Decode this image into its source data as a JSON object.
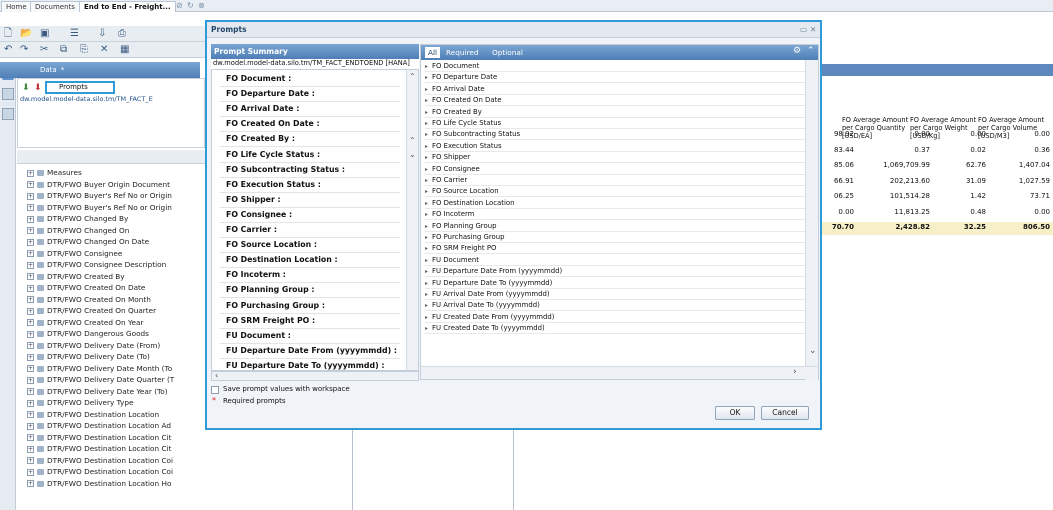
{
  "tabs": [
    {
      "label": "Home"
    },
    {
      "label": "Documents"
    },
    {
      "label": "End to End - Freight..."
    }
  ],
  "tab_icons": [
    "pin-icon",
    "refresh-icon",
    "close-icon"
  ],
  "left_panel": {
    "header": "Data",
    "prompts_label": "Prompts",
    "path": "dw.model.model-data.silo.tm/TM_FACT_E",
    "tree": [
      "Measures",
      "DTR/FWO Buyer Origin Document",
      "DTR/FWO Buyer's Ref No or Origin",
      "DTR/FWO Buyer's Ref No or Origin",
      "DTR/FWO Changed By",
      "DTR/FWO Changed On",
      "DTR/FWO Changed On Date",
      "DTR/FWO Consignee",
      "DTR/FWO Consignee Description",
      "DTR/FWO Created By",
      "DTR/FWO Created On Date",
      "DTR/FWO Created On Month",
      "DTR/FWO Created On Quarter",
      "DTR/FWO Created On Year",
      "DTR/FWO Dangerous Goods",
      "DTR/FWO Delivery Date (From)",
      "DTR/FWO Delivery Date (To)",
      "DTR/FWO Delivery Date Month (To",
      "DTR/FWO Delivery Date Quarter (T",
      "DTR/FWO Delivery Date Year (To)",
      "DTR/FWO Delivery Type",
      "DTR/FWO Destination Location",
      "DTR/FWO Destination Location Ad",
      "DTR/FWO Destination Location Cit",
      "DTR/FWO Destination Location Cit",
      "DTR/FWO Destination Location Coi",
      "DTR/FWO Destination Location Coi",
      "DTR/FWO Destination Location Ho"
    ]
  },
  "background_table": {
    "headers": [
      "FO Average Amount per Cargo Quantity [USD/EA]",
      "FO Average Amount per Cargo Weight [USD/Kg]",
      "FO Average Amount per Cargo Volume [USD/M3]"
    ],
    "rows": [
      [
        "98.92",
        "0.00",
        "0.00",
        "0.00"
      ],
      [
        "83.44",
        "0.37",
        "0.02",
        "0.36"
      ],
      [
        "85.06",
        "1,069,709.99",
        "62.76",
        "1,407.04"
      ],
      [
        "66.91",
        "202,213.60",
        "31.09",
        "1,027.59"
      ],
      [
        "06.25",
        "101,514.28",
        "1.42",
        "73.71"
      ],
      [
        "0.00",
        "11,813.25",
        "0.48",
        "0.00"
      ]
    ],
    "total": [
      "70.70",
      "2,428.82",
      "32.25",
      "806.50"
    ]
  },
  "dialog": {
    "title": "Prompts",
    "summary_header": "Prompt Summary",
    "summary_path": "dw.model.model-data.silo.tm/TM_FACT_ENDTOEND [HANA]",
    "summary_items": [
      "FO Document :",
      "FO Departure Date :",
      "FO Arrival Date :",
      "FO Created On Date :",
      "FO Created By :",
      "FO Life Cycle Status :",
      "FO Subcontracting Status :",
      "FO Execution Status :",
      "FO Shipper :",
      "FO Consignee :",
      "FO Carrier :",
      "FO Source Location :",
      "FO Destination Location :",
      "FO Incoterm :",
      "FO Planning Group :",
      "FO Purchasing Group :",
      "FO SRM Freight PO :",
      "FU Document :",
      "FU Departure Date From (yyyymmdd) :",
      "FU Departure Date To (yyyymmdd) :"
    ],
    "filter_tabs": [
      "All",
      "Required",
      "Optional"
    ],
    "prompt_list": [
      "FO Document",
      "FO Departure Date",
      "FO Arrival Date",
      "FO Created On Date",
      "FO Created By",
      "FO Life Cycle Status",
      "FO Subcontracting Status",
      "FO Execution Status",
      "FO Shipper",
      "FO Consignee",
      "FO Carrier",
      "FO Source Location",
      "FO Destination Location",
      "FO Incoterm",
      "FO Planning Group",
      "FO Purchasing Group",
      "FO SRM Freight PO",
      "FU Document",
      "FU Departure Date From (yyyymmdd)",
      "FU Departure Date To (yyyymmdd)",
      "FU Arrival Date From (yyyymmdd)",
      "FU Arrival Date To (yyyymmdd)",
      "FU Created Date From (yyyymmdd)",
      "FU Created Date To (yyyymmdd)"
    ],
    "save_label": "Save prompt values with workspace",
    "required_note": "Required prompts",
    "required_marker": "*",
    "ok_label": "OK",
    "cancel_label": "Cancel"
  },
  "colors": {
    "accent": "#2e9ad8",
    "header_blue": "#4d7eb6"
  }
}
